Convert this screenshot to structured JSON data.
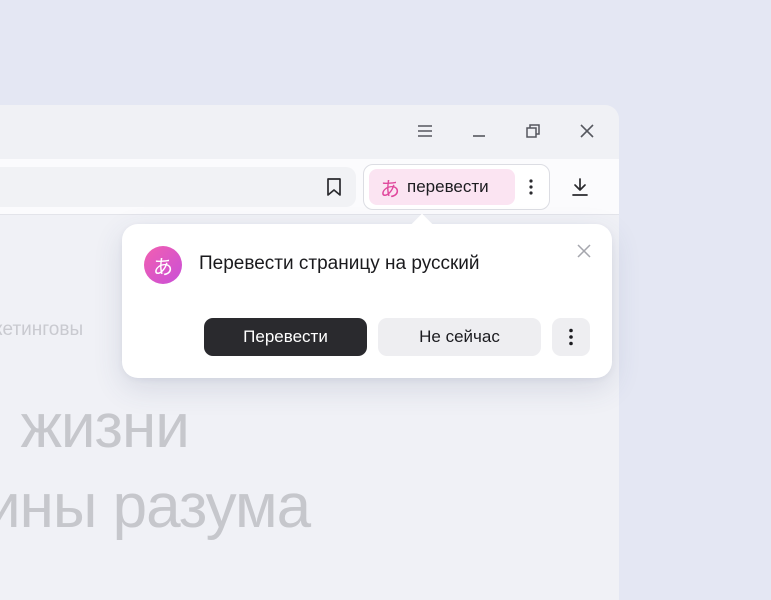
{
  "toolbar": {
    "translate_chip": {
      "glyph": "あ",
      "label": "перевести"
    }
  },
  "popup": {
    "logo_glyph": "あ",
    "title": "Перевести страницу на русский",
    "primary_button": "Перевести",
    "secondary_button": "Не сейчас"
  },
  "page": {
    "fragment_small": "кетинговы",
    "fragment_line1": "ı жизни",
    "fragment_line2": "ины разума"
  },
  "icons": {
    "window_menu": "menu-icon",
    "window_minimize": "minimize-icon",
    "window_restore": "restore-icon",
    "window_close": "close-icon",
    "bookmark": "bookmark-icon",
    "more": "more-vertical-icon",
    "download": "download-icon"
  },
  "colors": {
    "background": "#e4e7f3",
    "translate_chip_bg": "#fbe4f2",
    "translate_accent": "#e0489d",
    "primary_button": "#2a2a2e"
  }
}
